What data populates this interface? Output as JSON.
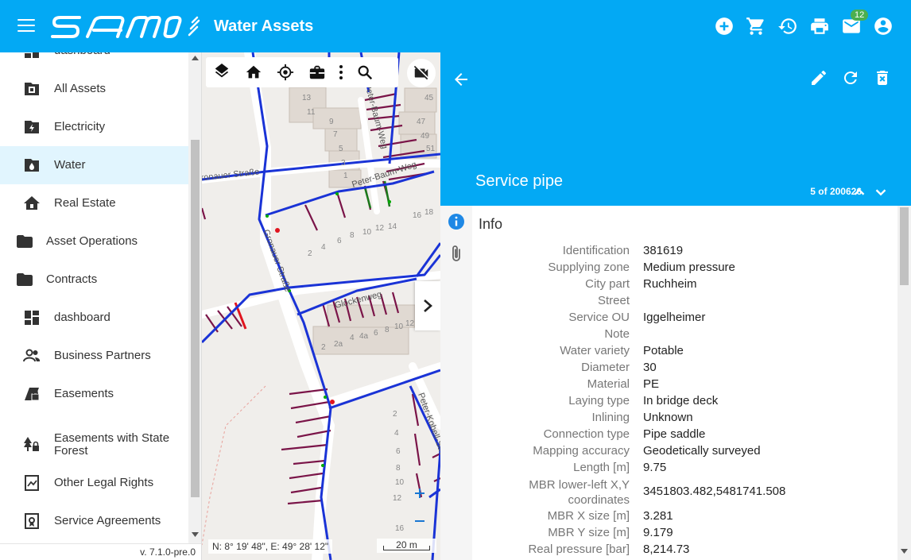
{
  "header": {
    "title": "Water Assets",
    "logo_text": "samo",
    "mail_badge": "12"
  },
  "sidebar": {
    "items": [
      {
        "label": "dashboard"
      },
      {
        "label": "All Assets"
      },
      {
        "label": "Electricity"
      },
      {
        "label": "Water"
      },
      {
        "label": "Real Estate"
      },
      {
        "label": "Asset Operations"
      },
      {
        "label": "Contracts"
      },
      {
        "label": "dashboard"
      },
      {
        "label": "Business Partners"
      },
      {
        "label": "Easements"
      },
      {
        "label": "Easements with State Forest"
      },
      {
        "label": "Other Legal Rights"
      },
      {
        "label": "Service Agreements"
      }
    ],
    "version": "v. 7.1.0-pre.0"
  },
  "map": {
    "coordinates": "N: 8° 19' 48\", E: 49° 28' 12\"",
    "scale": "20 m",
    "streets": [
      "Gronauer Straße",
      "Gronauer Straße",
      "Peter-Baum-Weg",
      "Peter-Baum-Weg",
      "Glockenweg",
      "Peter-Kobell-Straße"
    ],
    "house_numbers": [
      "13",
      "11",
      "9",
      "7",
      "5",
      "3",
      "1",
      "45",
      "47",
      "49",
      "51",
      "16",
      "18",
      "14",
      "12",
      "10",
      "8",
      "6",
      "4",
      "2",
      "2",
      "2a",
      "4",
      "4a",
      "6",
      "8",
      "10",
      "12",
      "2",
      "4",
      "6",
      "8",
      "10",
      "12",
      "16"
    ]
  },
  "panel": {
    "title": "Service pipe",
    "record_count": "5 of 200626",
    "section": "Info",
    "attributes": [
      {
        "label": "Identification",
        "value": "381619"
      },
      {
        "label": "Supplying zone",
        "value": "Medium pressure"
      },
      {
        "label": "City part",
        "value": "Ruchheim"
      },
      {
        "label": "Street",
        "value": ""
      },
      {
        "label": "Service OU",
        "value": "Iggelheimer"
      },
      {
        "label": "Note",
        "value": ""
      },
      {
        "label": "Water variety",
        "value": "Potable"
      },
      {
        "label": "Diameter",
        "value": "30"
      },
      {
        "label": "Material",
        "value": "PE"
      },
      {
        "label": "Laying type",
        "value": "In bridge deck"
      },
      {
        "label": "Inlining",
        "value": "Unknown"
      },
      {
        "label": "Connection type",
        "value": "Pipe saddle"
      },
      {
        "label": "Mapping accuracy",
        "value": "Geodetically surveyed"
      },
      {
        "label": "Length [m]",
        "value": "9.75"
      },
      {
        "label": "MBR lower-left X,Y coordinates",
        "value": "3451803.482,5481741.508"
      },
      {
        "label": "MBR X size [m]",
        "value": "3.281"
      },
      {
        "label": "MBR Y size [m]",
        "value": "9.179"
      },
      {
        "label": "Real pressure [bar]",
        "value": "8,214.73"
      }
    ]
  },
  "colors": {
    "primary": "#03a9f4",
    "active_nav": "#e1f5fe",
    "main_pipe": "#1a33d6",
    "service_pipe": "#7a1448",
    "badge": "#4caf50"
  }
}
